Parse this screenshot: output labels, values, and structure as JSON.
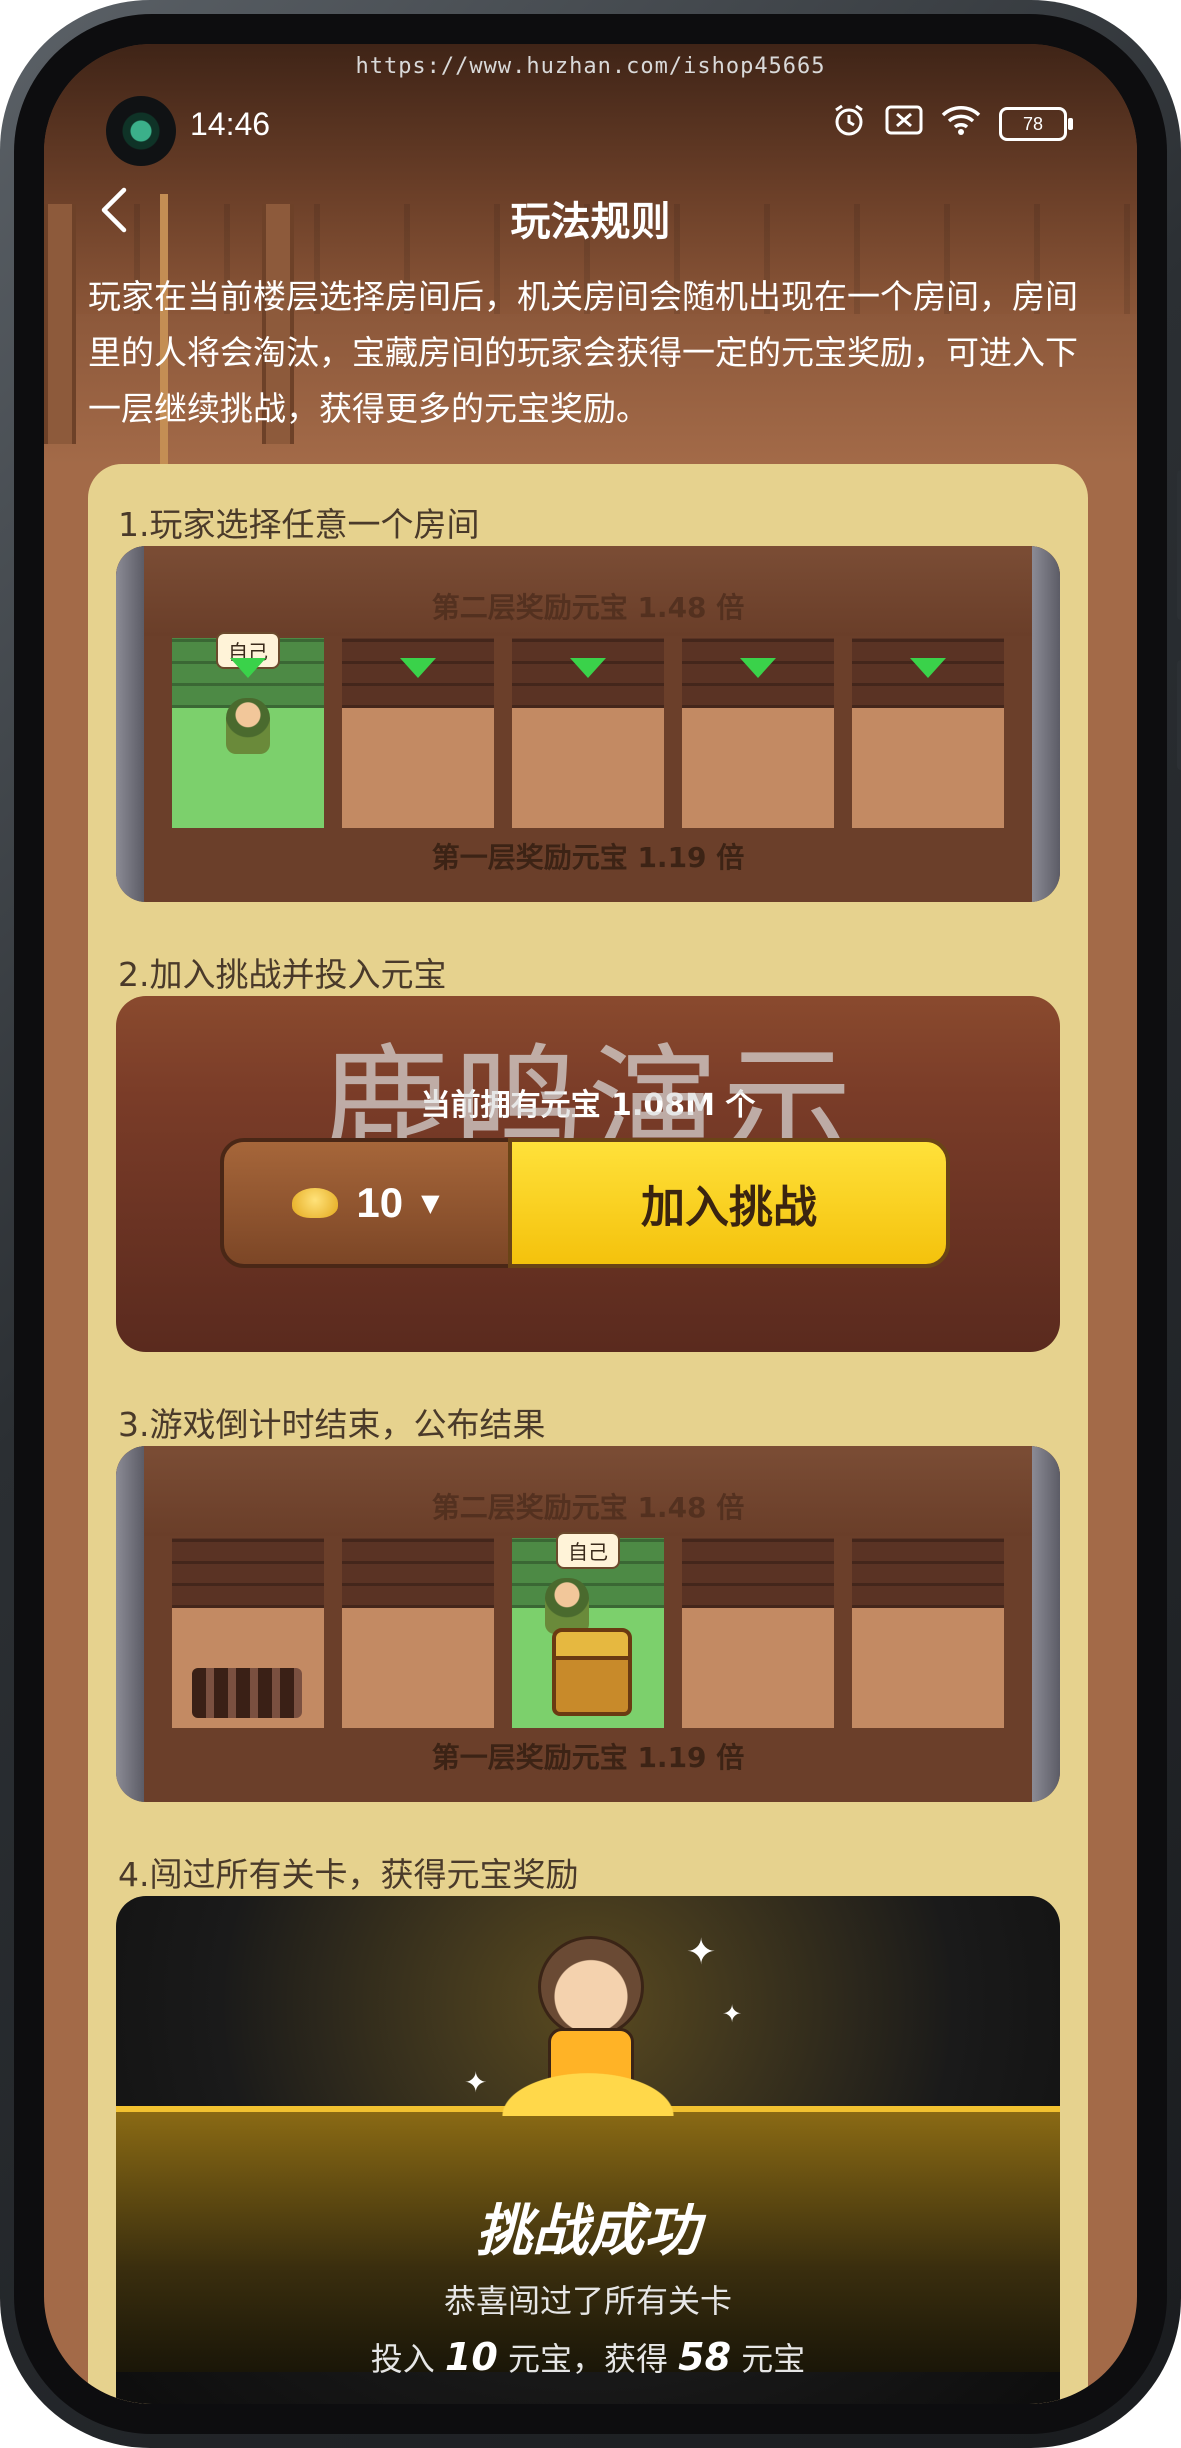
{
  "status_bar": {
    "time": "14:46",
    "battery": "78",
    "icons": [
      "alarm-icon",
      "sim-off-icon",
      "wifi-icon",
      "battery-icon"
    ]
  },
  "watermark_url": "https://www.huzhan.com/ishop45665",
  "header": {
    "title": "玩法规则",
    "back_icon": "chevron-left-icon"
  },
  "intro_text": "玩家在当前楼层选择房间后，机关房间会随机出现在一个房间，房间里的人将会淘汰，宝藏房间的玩家会获得一定的元宝奖励，可进入下一层继续挑战，获得更多的元宝奖励。",
  "steps": [
    {
      "label": "1.玩家选择任意一个房间",
      "top_text": "第二层奖励元宝 1.48 倍",
      "bottom_text": "第一层奖励元宝 1.19 倍",
      "self_tag": "自己"
    },
    {
      "label": "2.加入挑战并投入元宝",
      "owned_text": "当前拥有元宝 1.08M 个",
      "amount": "10",
      "join_label": "加入挑战",
      "watermark": "鹿鸣演示"
    },
    {
      "label": "3.游戏倒计时结束，公布结果",
      "top_text": "第二层奖励元宝 1.48 倍",
      "bottom_text": "第一层奖励元宝 1.19 倍",
      "self_tag": "自己"
    },
    {
      "label": "4.闯过所有关卡，获得元宝奖励",
      "success_title": "挑战成功",
      "success_sub": "恭喜闯过了所有关卡",
      "invest_prefix": "投入",
      "invest_amount": "10",
      "invest_unit": "元宝，获得",
      "reward_amount": "58",
      "reward_unit": "元宝"
    }
  ],
  "colors": {
    "card_bg": "#e6d28e",
    "join_button": "#f4c20c",
    "screen_bg": "#a36a48"
  }
}
